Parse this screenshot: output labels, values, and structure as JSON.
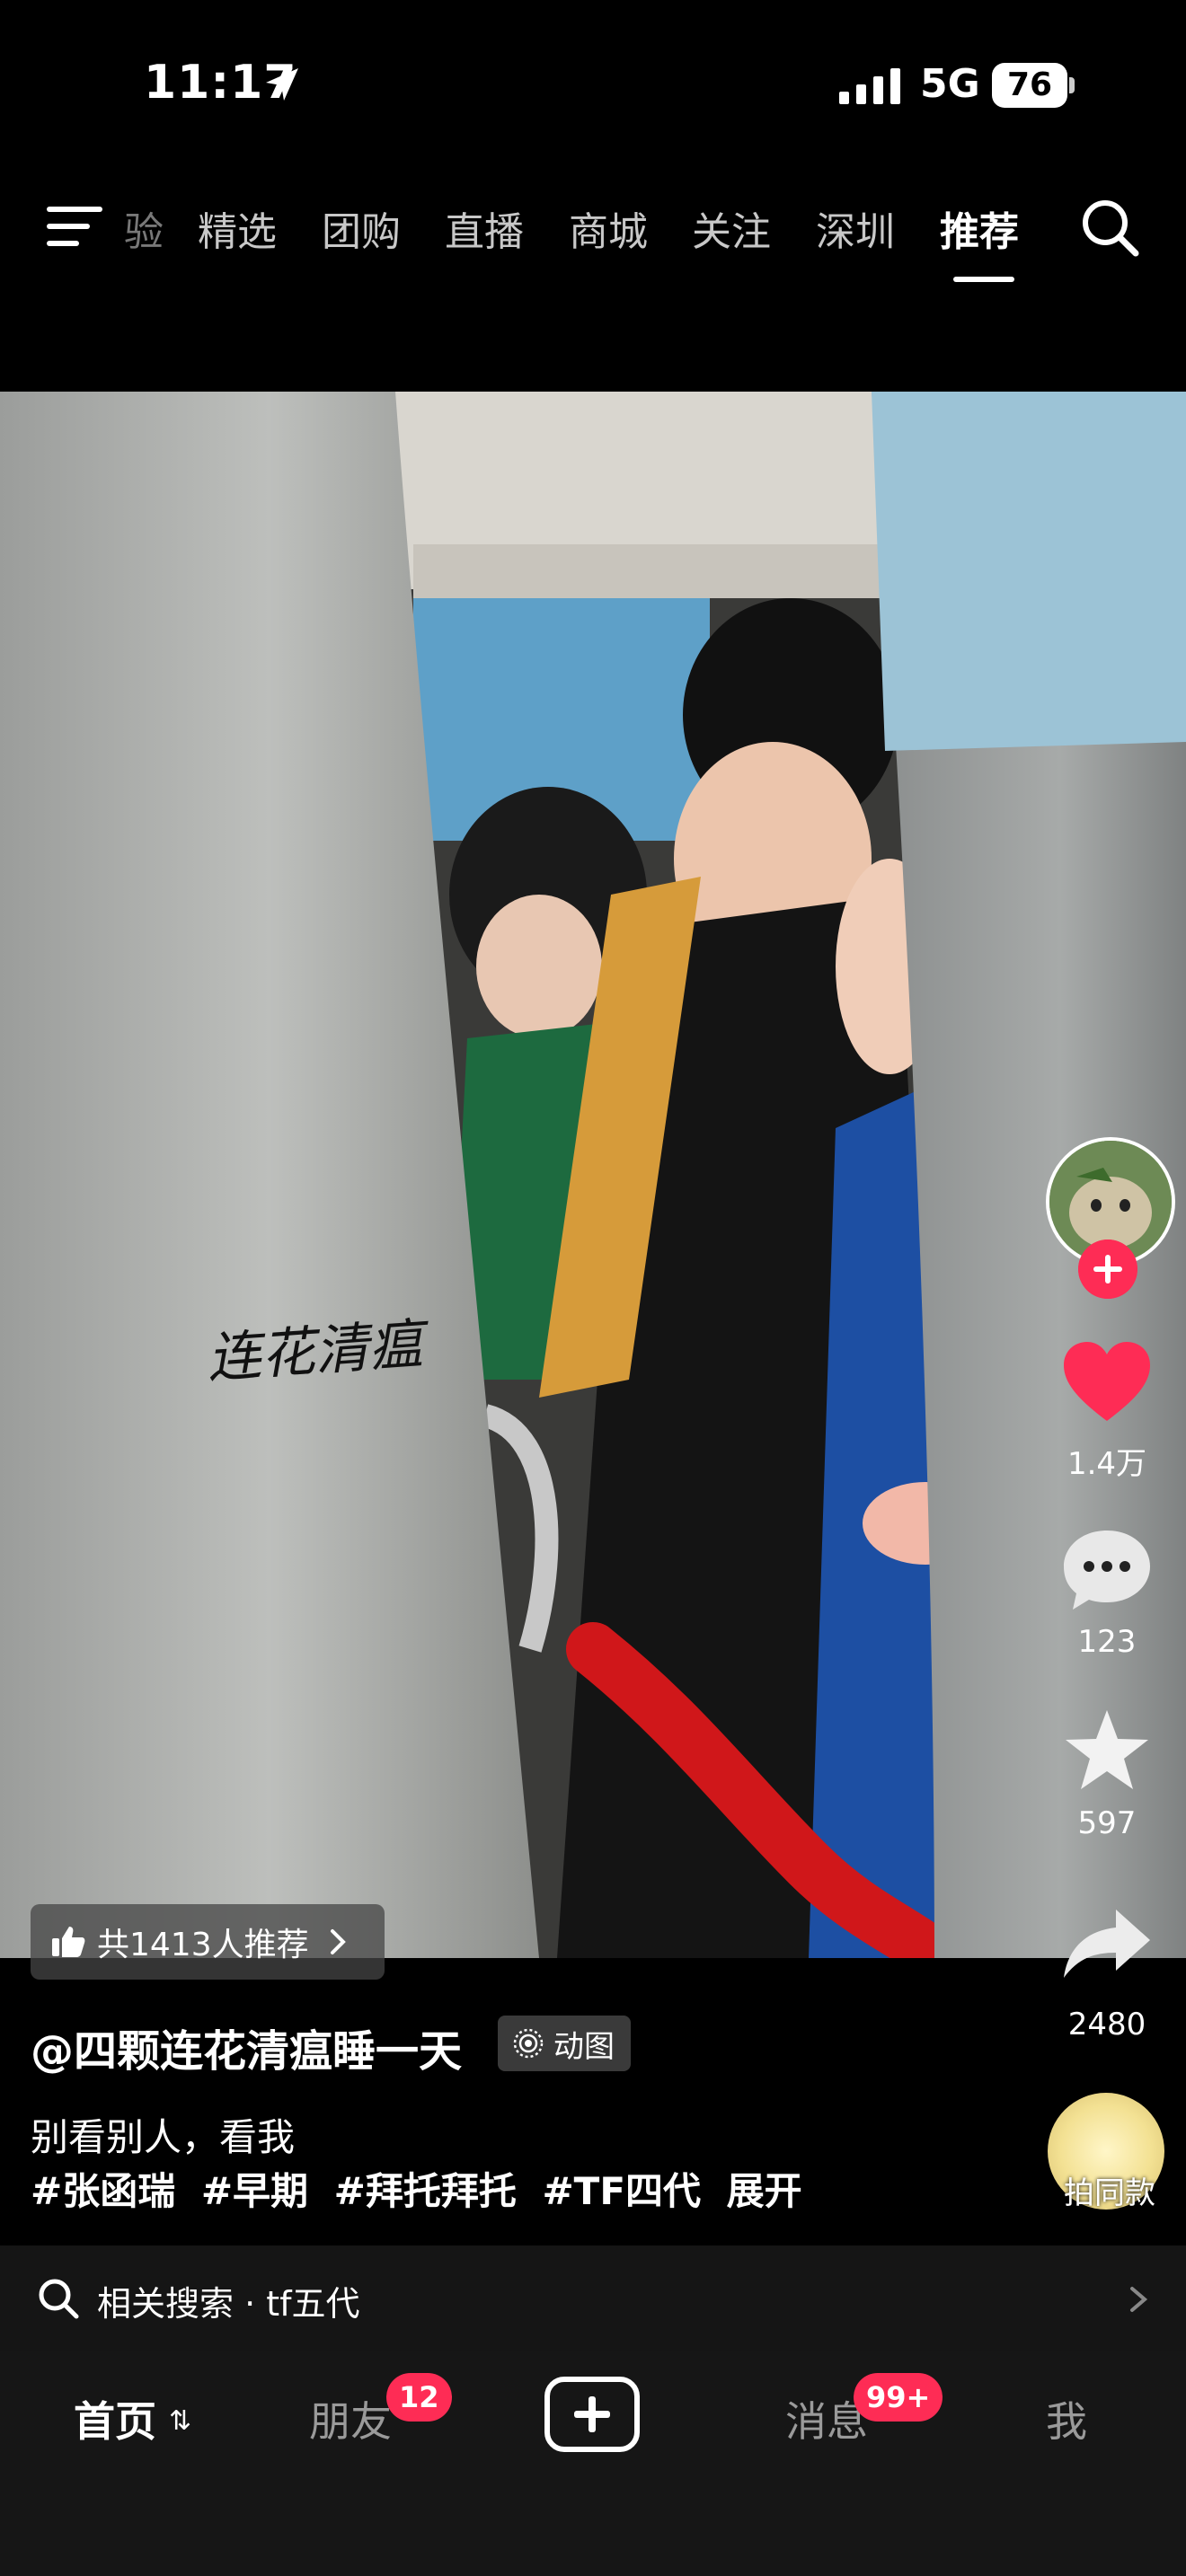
{
  "status_bar": {
    "time": "11:17",
    "network": "5G",
    "battery": "76"
  },
  "top_tabs": [
    {
      "label": "验"
    },
    {
      "label": "精选"
    },
    {
      "label": "团购"
    },
    {
      "label": "直播"
    },
    {
      "label": "商城"
    },
    {
      "label": "关注"
    },
    {
      "label": "深圳"
    },
    {
      "label": "推荐",
      "active": true
    }
  ],
  "video": {
    "watermark": "连花清瘟",
    "recommend_pill": "共1413人推荐"
  },
  "right_rail": {
    "likes": "1.4万",
    "comments": "123",
    "favorites": "597",
    "shares": "2480",
    "same_style": "拍同款"
  },
  "post": {
    "author": "@四颗连花清瘟睡一天",
    "badge": "动图",
    "caption": "别看别人，看我",
    "hashtags": [
      "#张函瑞",
      "#早期",
      "#拜托拜托",
      "#TF四代"
    ],
    "expand": "展开"
  },
  "related_search": {
    "label": "相关搜索 · tf五代"
  },
  "bottom_nav": {
    "home": "首页",
    "friends": "朋友",
    "friends_badge": "12",
    "messages": "消息",
    "messages_badge": "99+",
    "me": "我"
  },
  "colors": {
    "accent": "#fe2c55",
    "like": "#fe2c55",
    "background": "#000000"
  }
}
